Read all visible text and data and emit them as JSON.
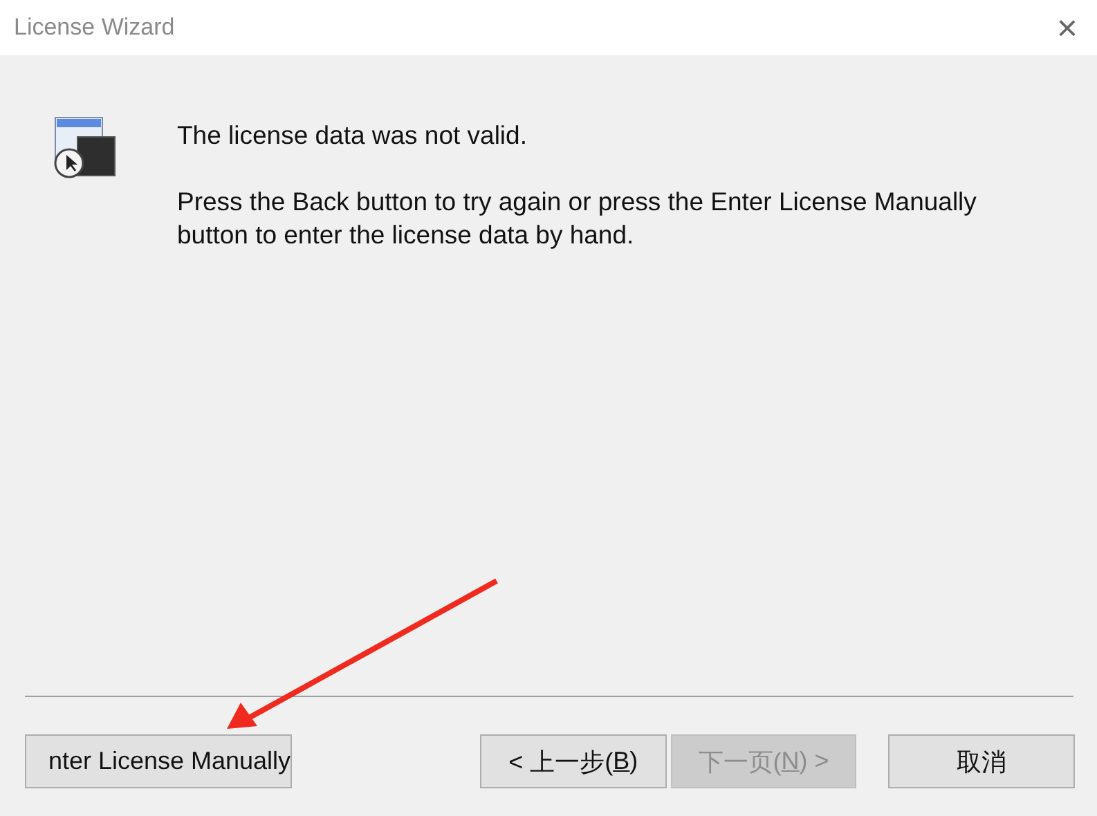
{
  "window": {
    "title": "License Wizard",
    "close": "×"
  },
  "message": {
    "heading": "The license data was not valid.",
    "body": "Press the Back button to try again or press the Enter License Manually button to enter the license data by hand."
  },
  "buttons": [
    {
      "kind": "manual",
      "label": "nter License Manually",
      "disabled": false
    },
    {
      "kind": "back",
      "before": "< 上一步(",
      "key": "B",
      "after": ")",
      "disabled": false
    },
    {
      "kind": "next",
      "before": "下一页(",
      "key": "N",
      "after": ") >",
      "disabled": true
    },
    {
      "kind": "cancel",
      "before": "取消",
      "disabled": false
    }
  ]
}
